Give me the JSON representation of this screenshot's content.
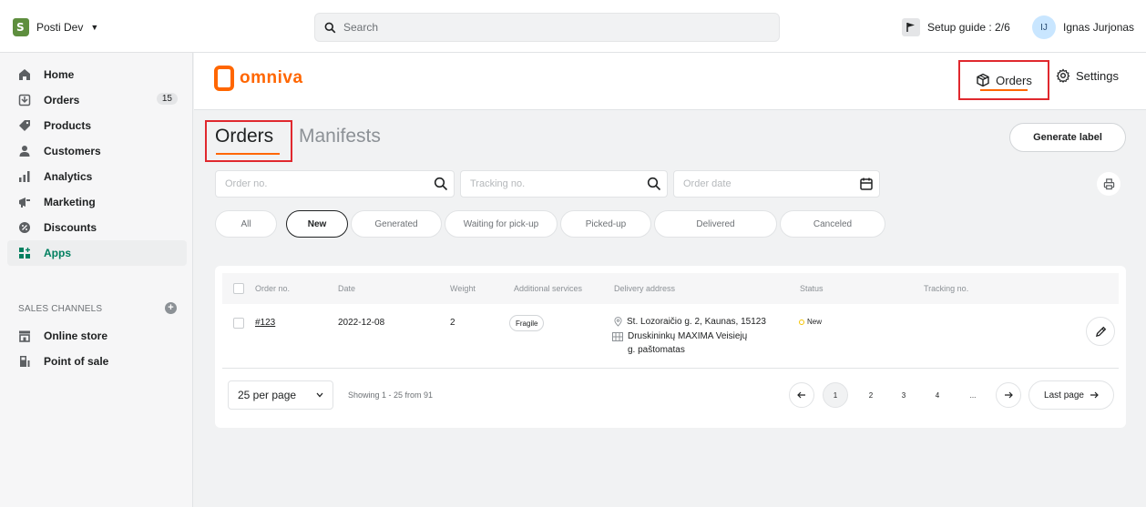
{
  "topbar": {
    "store_name": "Posti Dev",
    "search_placeholder": "Search",
    "setup_guide": "Setup guide : 2/6",
    "user_initials": "IJ",
    "user_name": "Ignas Jurjonas"
  },
  "sidebar": {
    "items": [
      {
        "label": "Home",
        "icon": "home-icon"
      },
      {
        "label": "Orders",
        "icon": "orders-icon",
        "badge": "15"
      },
      {
        "label": "Products",
        "icon": "tag-icon"
      },
      {
        "label": "Customers",
        "icon": "person-icon"
      },
      {
        "label": "Analytics",
        "icon": "bar-chart-icon"
      },
      {
        "label": "Marketing",
        "icon": "megaphone-icon"
      },
      {
        "label": "Discounts",
        "icon": "discount-icon"
      },
      {
        "label": "Apps",
        "icon": "apps-icon"
      }
    ],
    "channels_title": "SALES CHANNELS",
    "channels": [
      {
        "label": "Online store",
        "icon": "store-icon"
      },
      {
        "label": "Point of sale",
        "icon": "pos-icon"
      }
    ]
  },
  "app": {
    "brand": "omniva",
    "nav_orders": "Orders",
    "nav_settings": "Settings",
    "tab_orders": "Orders",
    "tab_manifests": "Manifests",
    "generate_label": "Generate label",
    "filters": {
      "order_no_placeholder": "Order no.",
      "tracking_placeholder": "Tracking no.",
      "date_placeholder": "Order date"
    },
    "status_pills": [
      "All",
      "New",
      "Generated",
      "Waiting for pick-up",
      "Picked-up",
      "Delivered",
      "Canceled"
    ],
    "active_pill": "New",
    "accent_color": "#ff6600"
  },
  "table": {
    "columns": [
      "Order no.",
      "Date",
      "Weight",
      "Additional services",
      "Delivery address",
      "Status",
      "Tracking no."
    ],
    "rows": [
      {
        "order_no": "#123",
        "date": "2022-12-08",
        "weight": "2",
        "service": "Fragile",
        "address_line1": "St. Lozoraičio g. 2, Kaunas, 15123",
        "address_line2": "Druskininkų MAXIMA Veisiejų",
        "address_line3": "g. paštomatas",
        "status": "New",
        "tracking": ""
      }
    ],
    "per_page": "25 per page",
    "showing": "Showing 1 - 25 from 91",
    "pages": [
      "1",
      "2",
      "3",
      "4",
      "..."
    ],
    "last_page": "Last page"
  }
}
